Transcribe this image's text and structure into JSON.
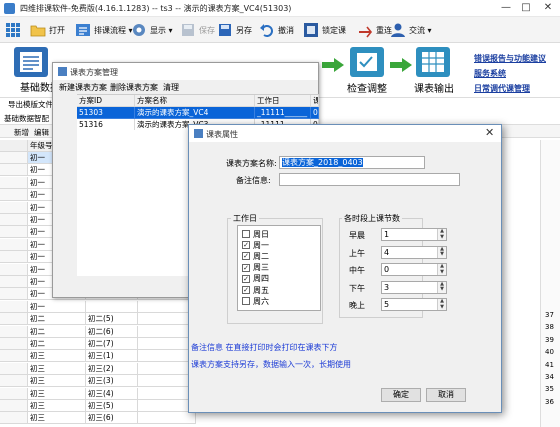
{
  "window": {
    "title": "四维排课软件-免费版(4.16.1.1283) -- ts3 -- 演示的课表方案_VC4(51303)",
    "controls": [
      "—",
      "□",
      "✕"
    ]
  },
  "toolbar": {
    "items": [
      {
        "label": "打开",
        "icon": "folder-open-icon"
      },
      {
        "label": "排课流程 ▾",
        "icon": "flow-icon"
      },
      {
        "label": "显示 ▾",
        "icon": "display-icon"
      },
      {
        "label": "保存",
        "icon": "save-icon",
        "disabled": true
      },
      {
        "label": "另存",
        "icon": "save-as-icon"
      },
      {
        "label": "撤消",
        "icon": "undo-icon"
      },
      {
        "label": "锁定课",
        "icon": "lock-icon"
      },
      {
        "label": "重连",
        "icon": "reconnect-icon"
      },
      {
        "label": "交流 ▾",
        "icon": "users-icon"
      }
    ]
  },
  "nav": {
    "left_label": "基础数据",
    "steps": [
      {
        "label": "检查调整",
        "color": "#2e8fbf"
      },
      {
        "label": "课表输出",
        "color": "#2e8fbf"
      }
    ],
    "links": [
      "错误报告与功能建议",
      "服务系统",
      "日常调代课管理"
    ]
  },
  "bg_panel": {
    "export_label": "导出模版文件",
    "tab_label": "基础数据智配",
    "new_label": "新增",
    "edit_label": "编辑",
    "grid_header": "年级号",
    "rows": [
      [
        "初一",
        ""
      ],
      [
        "初一",
        ""
      ],
      [
        "初一",
        ""
      ],
      [
        "初一",
        ""
      ],
      [
        "初一",
        ""
      ],
      [
        "初一",
        ""
      ],
      [
        "初一",
        ""
      ],
      [
        "初一",
        ""
      ],
      [
        "初一",
        ""
      ],
      [
        "初一",
        ""
      ],
      [
        "初一",
        ""
      ],
      [
        "初一",
        ""
      ],
      [
        "初一",
        ""
      ],
      [
        "初二",
        "初二(5)"
      ],
      [
        "初二",
        "初二(6)"
      ],
      [
        "初二",
        "初二(7)"
      ],
      [
        "初三",
        "初三(1)"
      ],
      [
        "初三",
        "初三(2)"
      ],
      [
        "初三",
        "初三(3)"
      ],
      [
        "初三",
        "初三(4)"
      ],
      [
        "初三",
        "初三(5)"
      ],
      [
        "初三",
        "初三(6)"
      ]
    ],
    "right_numbers": [
      "37",
      "38",
      "39",
      "40",
      "41",
      "34",
      "35",
      "36"
    ]
  },
  "manage_dialog": {
    "title": "课表方案管理",
    "menu": [
      "新建课表方案",
      "删除课表方案",
      "清理"
    ],
    "columns": [
      "方案ID",
      "方案名称",
      "工作日",
      "课"
    ],
    "rows": [
      {
        "id": "51303",
        "name": "演示的课表方案_VC4",
        "workdays": "_11111______",
        "extra": "0,",
        "selected": true
      },
      {
        "id": "51316",
        "name": "演示的课表方案_VC3",
        "workdays": "_11111______",
        "extra": "0,",
        "selected": false
      }
    ]
  },
  "prop_dialog": {
    "title": "课表属性",
    "name_label": "课表方案名称:",
    "name_value": "课表方案_2018_0403",
    "note_label": "备注信息:",
    "note_value": "",
    "workday_group": "工作日",
    "days": [
      {
        "label": "周日",
        "checked": false
      },
      {
        "label": "周一",
        "checked": true
      },
      {
        "label": "周二",
        "checked": true
      },
      {
        "label": "周三",
        "checked": true
      },
      {
        "label": "周四",
        "checked": true
      },
      {
        "label": "周五",
        "checked": true
      },
      {
        "label": "周六",
        "checked": false
      }
    ],
    "period_group": "各时段上课节数",
    "periods": [
      {
        "label": "早晨",
        "value": "1"
      },
      {
        "label": "上午",
        "value": "4"
      },
      {
        "label": "中午",
        "value": "0"
      },
      {
        "label": "下午",
        "value": "3"
      },
      {
        "label": "晚上",
        "value": "5"
      }
    ],
    "hint1": "备注信息 在直接打印时会打印在课表下方",
    "hint2": "课表方案支持另存，数据输入一次，长期使用",
    "ok": "确定",
    "cancel": "取消",
    "hint_color": "#1d3cd6"
  }
}
